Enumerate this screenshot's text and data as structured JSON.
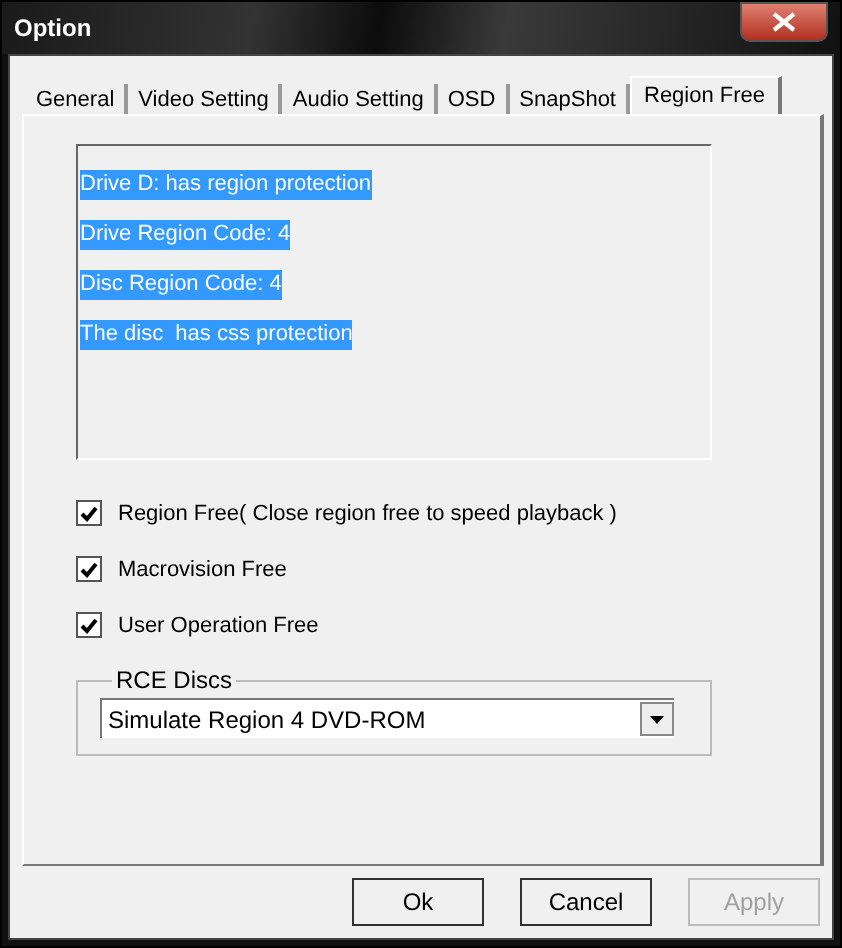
{
  "window": {
    "title": "Option"
  },
  "tabs": [
    {
      "label": "General",
      "selected": false
    },
    {
      "label": "Video Setting",
      "selected": false
    },
    {
      "label": "Audio Setting",
      "selected": false
    },
    {
      "label": "OSD",
      "selected": false
    },
    {
      "label": "SnapShot",
      "selected": false
    },
    {
      "label": "Region Free",
      "selected": true
    }
  ],
  "info_lines": [
    {
      "text": "Drive D: has region protection",
      "selected": true
    },
    {
      "text": "Drive Region Code: 4",
      "selected": true
    },
    {
      "text": "Disc Region Code: 4",
      "selected": true
    },
    {
      "text": "The disc  has css protection",
      "selected": true
    }
  ],
  "options": [
    {
      "label": "Region Free( Close region free to speed playback )",
      "checked": true
    },
    {
      "label": "Macrovision Free",
      "checked": true
    },
    {
      "label": "User Operation Free",
      "checked": true
    }
  ],
  "rce_discs": {
    "title": "RCE Discs",
    "value": "Simulate Region 4 DVD-ROM"
  },
  "buttons": [
    {
      "label": "Ok",
      "disabled": false
    },
    {
      "label": "Cancel",
      "disabled": false
    },
    {
      "label": "Apply",
      "disabled": true
    }
  ]
}
